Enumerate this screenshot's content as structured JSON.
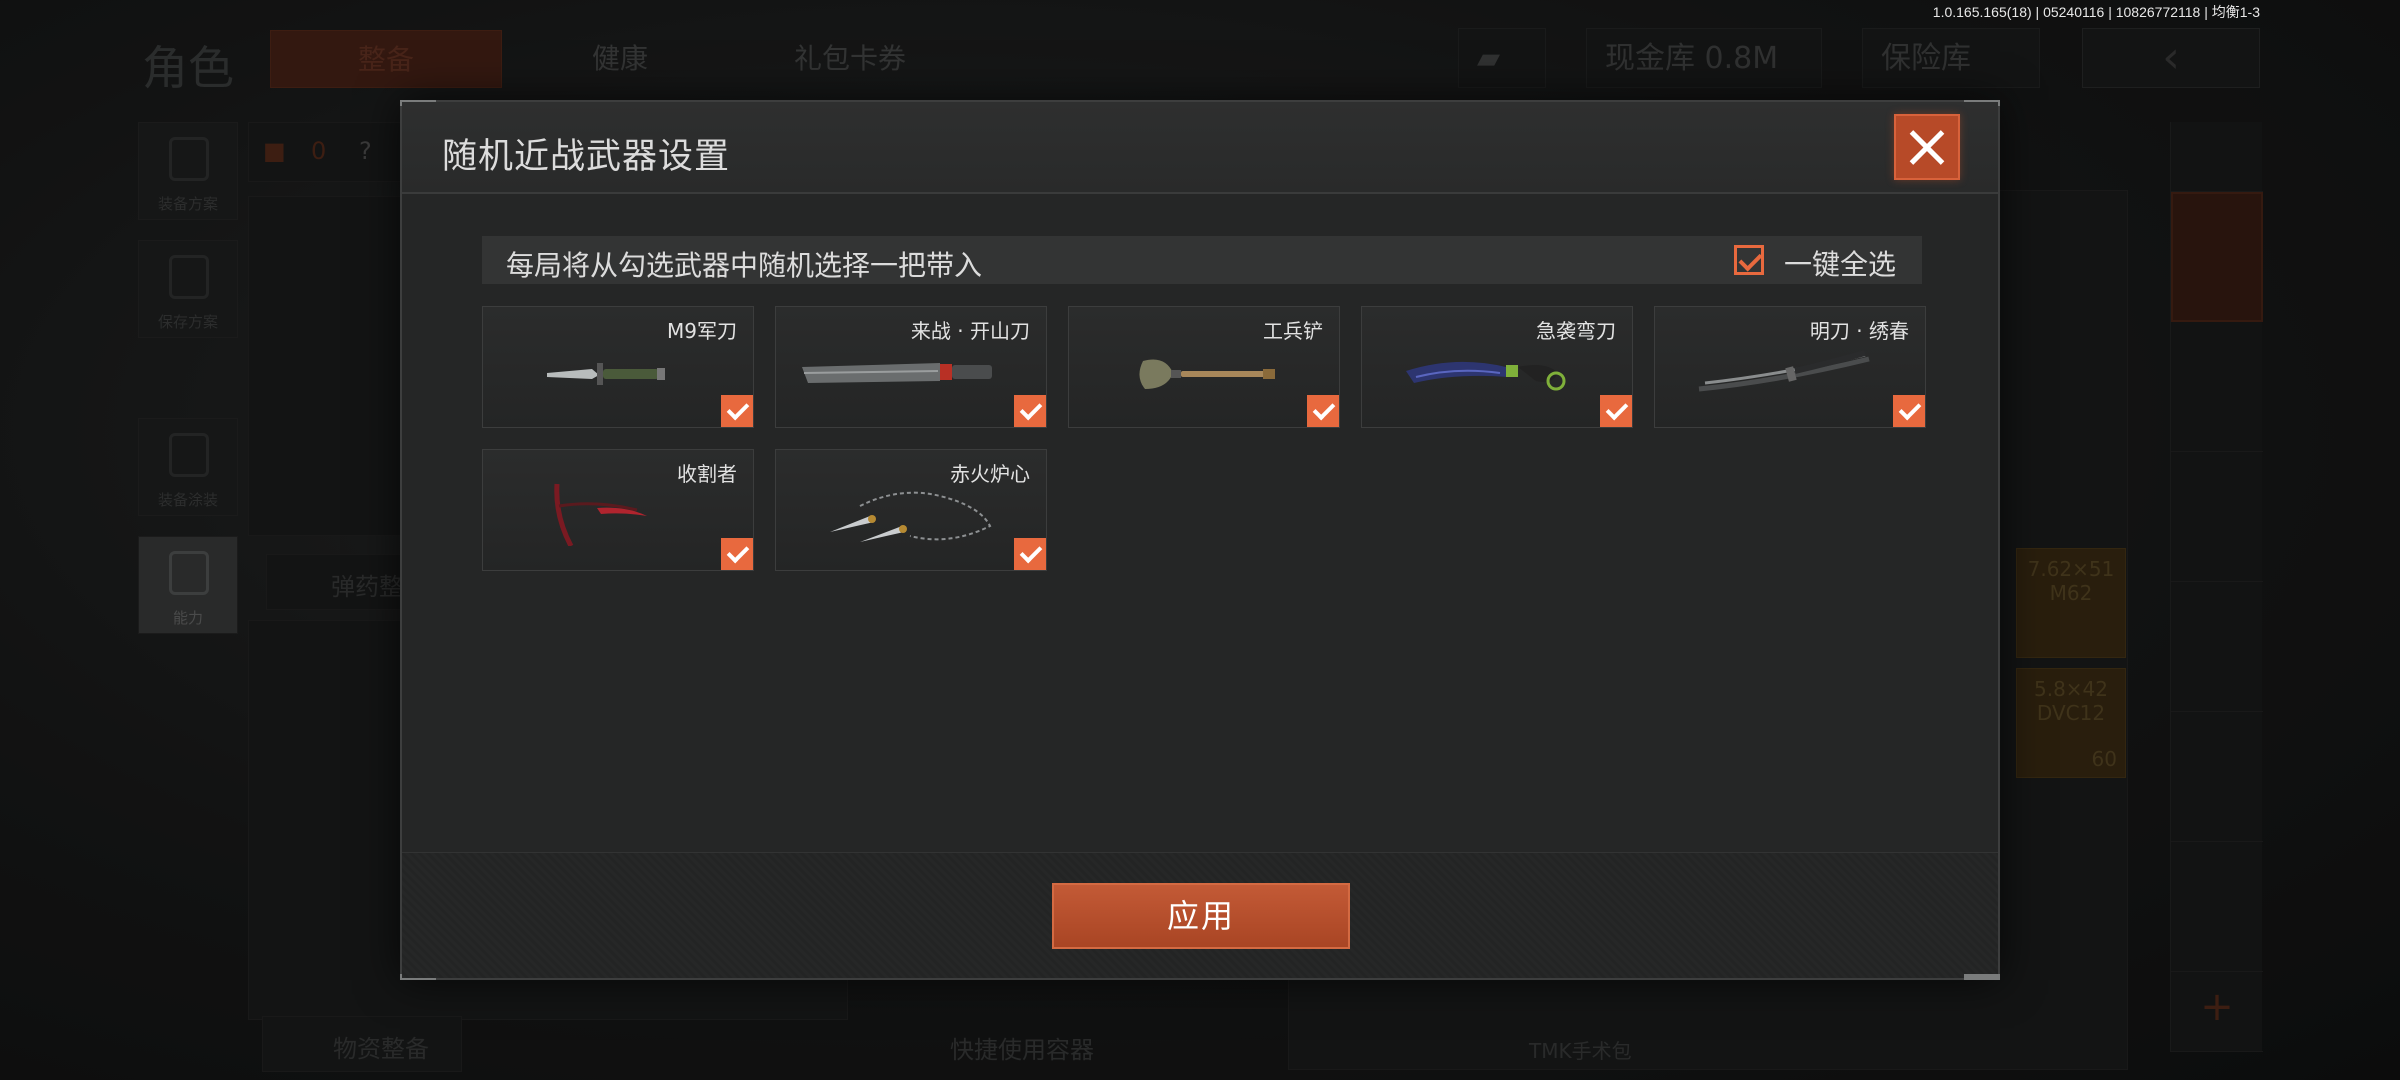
{
  "version_info": "1.0.165.165(18) | 05240116 | 10826772118 | 均衡1-3",
  "background": {
    "title": "角色",
    "tabs": [
      {
        "label": "整备",
        "active": true
      },
      {
        "label": "健康",
        "active": false
      },
      {
        "label": "礼包卡券",
        "active": false
      }
    ],
    "currency_count": "0",
    "cash_vault": "现金库 0.8M",
    "safe_vault": "保险库",
    "left_nav": [
      {
        "label": "装备方案"
      },
      {
        "label": "保存方案"
      },
      {
        "label": "装备涂装"
      },
      {
        "label": "能力",
        "active": true
      }
    ],
    "backpack_count": "0",
    "help_mark": "?",
    "ammo_section": "弹药整",
    "supplies_section": "物资整备",
    "quick_container": "快捷使用容器",
    "item_label": "TMK手术包",
    "ammo_slots": [
      {
        "caliber": "7.62×51",
        "name": "M62"
      },
      {
        "caliber": "5.8×42",
        "name": "DVC12",
        "count": "60"
      }
    ]
  },
  "modal": {
    "title": "随机近战武器设置",
    "info_text": "每局将从勾选武器中随机选择一把带入",
    "select_all_label": "一键全选",
    "select_all_checked": true,
    "apply_label": "应用",
    "accent_color": "#e8693e",
    "weapons": [
      {
        "name": "M9军刀",
        "icon": "combat-knife-icon",
        "checked": true
      },
      {
        "name": "来战 · 开山刀",
        "icon": "machete-icon",
        "checked": true
      },
      {
        "name": "工兵铲",
        "icon": "shovel-icon",
        "checked": true
      },
      {
        "name": "急袭弯刀",
        "icon": "karambit-icon",
        "checked": true
      },
      {
        "name": "明刀 · 绣春",
        "icon": "katana-icon",
        "checked": true
      },
      {
        "name": "收割者",
        "icon": "scythe-icon",
        "checked": true
      },
      {
        "name": "赤火炉心",
        "icon": "chain-dart-icon",
        "checked": true
      }
    ]
  }
}
